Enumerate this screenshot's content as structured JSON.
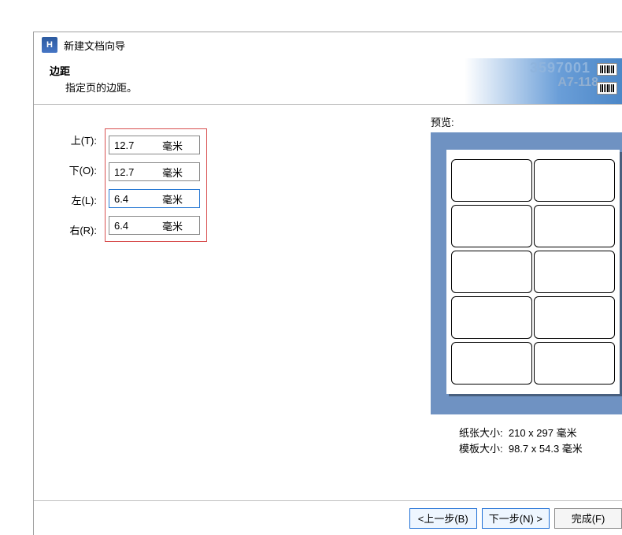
{
  "window": {
    "title": "新建文档向导"
  },
  "header": {
    "title": "边距",
    "subtitle": "指定页的边距。",
    "deco_digits": "3597001",
    "deco_label": "A7-118"
  },
  "margins": {
    "top_label": "上(T):",
    "bottom_label": "下(O):",
    "left_label": "左(L):",
    "right_label": "右(R):",
    "top_value": "12.7",
    "bottom_value": "12.7",
    "left_value": "6.4",
    "right_value": "6.4",
    "unit": "毫米"
  },
  "preview": {
    "label": "预览:",
    "paper_label": "纸张大小:",
    "paper_value": "210 x 297 毫米",
    "template_label": "模板大小:",
    "template_value": "98.7 x 54.3 毫米"
  },
  "buttons": {
    "back": "<上一步(B)",
    "next": "下一步(N) >",
    "finish": "完成(F)"
  }
}
